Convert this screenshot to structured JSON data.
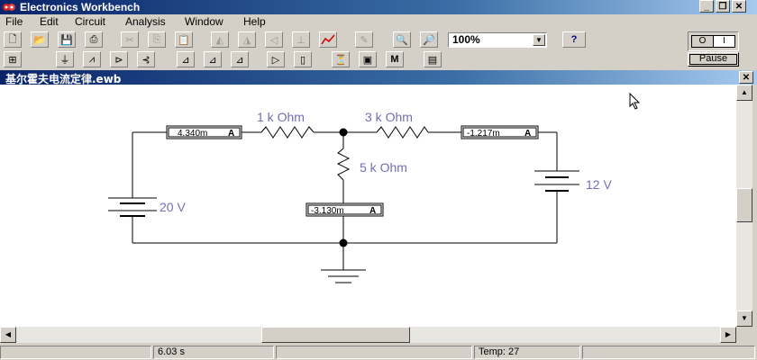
{
  "app": {
    "title": "Electronics Workbench"
  },
  "menu": [
    "File",
    "Edit",
    "Circuit",
    "Analysis",
    "Window",
    "Help"
  ],
  "toolbar": {
    "zoom_value": "100%",
    "help_label": "?"
  },
  "controls": {
    "power_off": "O",
    "power_on": "I",
    "pause_label": "Pause"
  },
  "document": {
    "title": "基尔霍夫电流定律.ewb"
  },
  "circuit": {
    "r1_label": "1 k Ohm",
    "r2_label": "3 k Ohm",
    "r3_label": "5 k Ohm",
    "v1_label": "20 V",
    "v2_label": "12 V",
    "ammeter1": "4.340m",
    "ammeter2": "-1.217m",
    "ammeter3": "-3.130m",
    "ammeter_unit": "A",
    "label_color": "#7070b8"
  },
  "status": {
    "time": "6.03 s",
    "temp": "Temp:  27"
  }
}
